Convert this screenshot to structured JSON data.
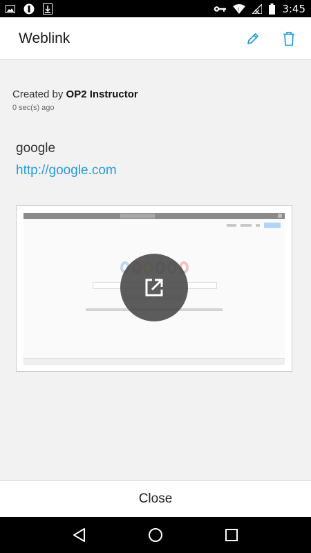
{
  "status_bar": {
    "time": "3:45",
    "icons": [
      "image-icon",
      "shield-icon",
      "download-icon",
      "key-icon",
      "wifi-icon",
      "no-signal-icon",
      "battery-icon"
    ]
  },
  "app_bar": {
    "title": "Weblink",
    "actions": [
      "edit-icon",
      "delete-icon"
    ],
    "accent": "#2a9ad6"
  },
  "weblink": {
    "created_by_prefix": "Created by",
    "author": "OP2 Instructor",
    "timestamp": "0 sec(s) ago",
    "name": "google",
    "url": "http://google.com"
  },
  "preview": {
    "overlay_icon": "open-external-icon"
  },
  "footer": {
    "close_label": "Close"
  },
  "nav_bar": {
    "buttons": [
      "back-icon",
      "home-icon",
      "recents-icon"
    ]
  }
}
